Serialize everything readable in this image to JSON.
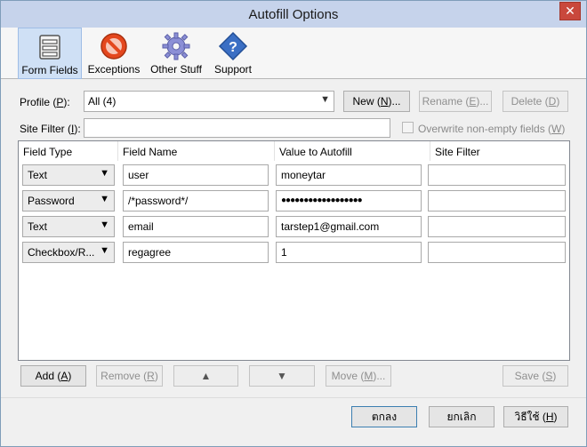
{
  "window": {
    "title": "Autofill Options",
    "close_glyph": "✕"
  },
  "toolbar": {
    "tabs": [
      {
        "label": "Form Fields",
        "icon": "form-fields-icon",
        "active": true
      },
      {
        "label": "Exceptions",
        "icon": "no-entry-icon",
        "active": false
      },
      {
        "label": "Other Stuff",
        "icon": "gear-icon",
        "active": false
      },
      {
        "label": "Support",
        "icon": "help-diamond-icon",
        "active": false
      }
    ]
  },
  "profile": {
    "label_pre": "Profile (",
    "label_key": "P",
    "label_post": "):",
    "value": "All (4)",
    "buttons": {
      "new": {
        "pre": "New (",
        "key": "N",
        "post": ")..."
      },
      "rename": {
        "pre": "Rename (",
        "key": "E",
        "post": ")..."
      },
      "delete": {
        "pre": "Delete (",
        "key": "D",
        "post": ")"
      }
    }
  },
  "site_filter": {
    "label_pre": "Site Filter (",
    "label_key": "I",
    "label_post": "):",
    "value": "",
    "overwrite_pre": "Overwrite non-empty fields (",
    "overwrite_key": "W",
    "overwrite_post": ")"
  },
  "table": {
    "headers": [
      "Field Type",
      "Field Name",
      "Value to Autofill",
      "Site Filter"
    ],
    "rows": [
      {
        "type": "Text",
        "name": "user",
        "value": "moneytar",
        "filter": ""
      },
      {
        "type": "Password",
        "name": "/*password*/",
        "value": "●●●●●●●●●●●●●●●●●●",
        "filter": ""
      },
      {
        "type": "Text",
        "name": "email",
        "value": "tarstep1@gmail.com",
        "filter": ""
      },
      {
        "type": "Checkbox/R...",
        "name": "regagree",
        "value": "1",
        "filter": ""
      }
    ]
  },
  "actions": {
    "add": {
      "pre": "Add (",
      "key": "A",
      "post": ")"
    },
    "remove": {
      "pre": "Remove (",
      "key": "R",
      "post": ")"
    },
    "up": "▲",
    "down": "▼",
    "move": {
      "pre": "Move (",
      "key": "M",
      "post": ")..."
    },
    "save": {
      "pre": "Save (",
      "key": "S",
      "post": ")"
    }
  },
  "dialog": {
    "ok": "ตกลง",
    "cancel": "ยกเลิก",
    "help": {
      "pre": "วิธีใช้ (",
      "key": "H",
      "post": ")"
    }
  },
  "colors": {
    "titlebar": "#c6d3eb",
    "active_tab": "#cfe0f5",
    "close_button": "#c9483c",
    "default_border": "#3c7fb1"
  }
}
